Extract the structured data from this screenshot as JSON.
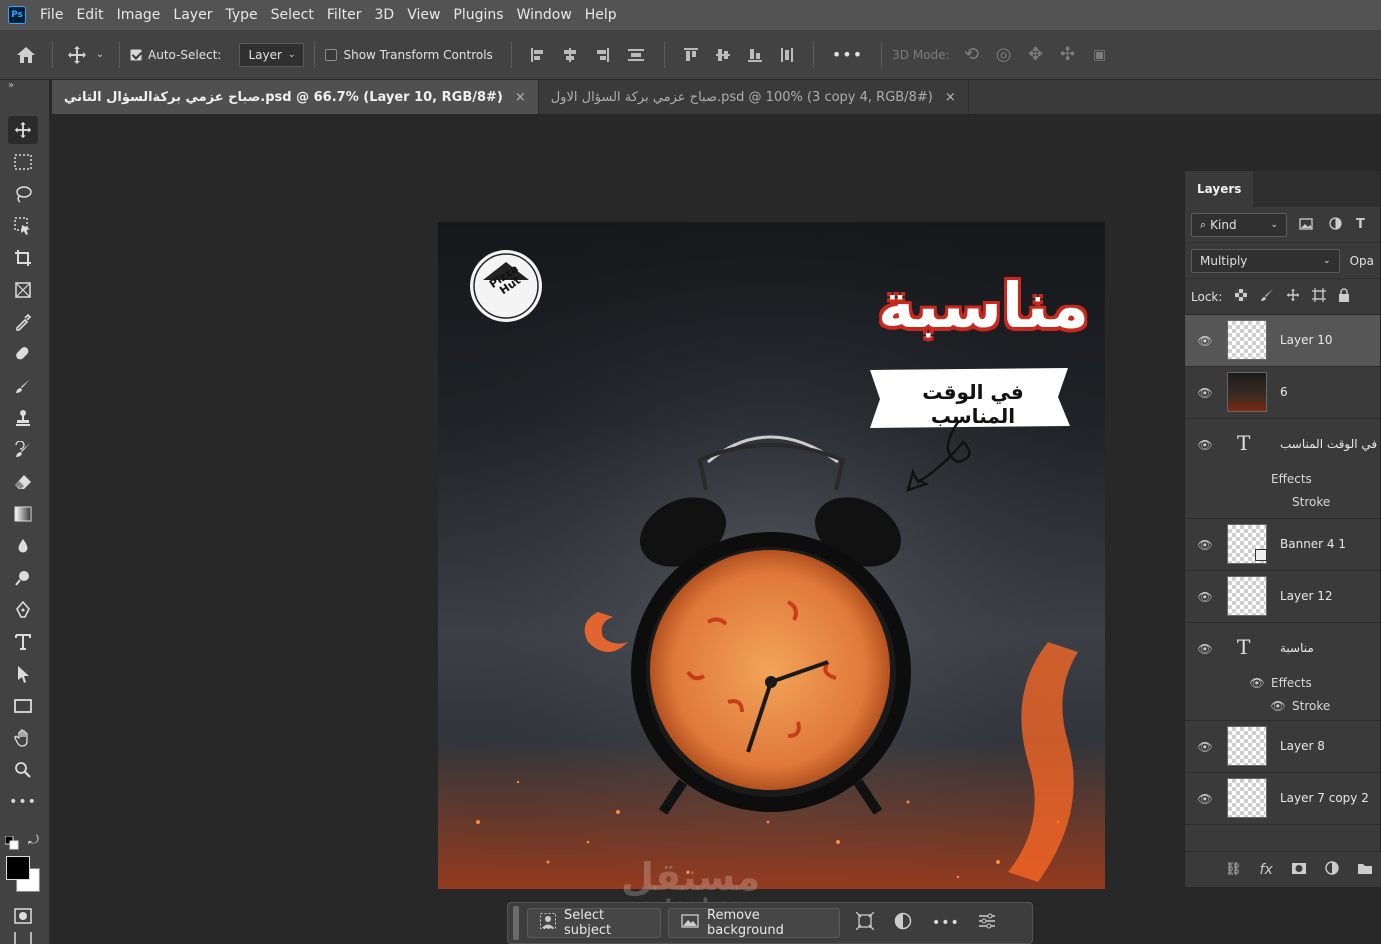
{
  "app": {
    "logo": "Ps"
  },
  "menu": [
    "File",
    "Edit",
    "Image",
    "Layer",
    "Type",
    "Select",
    "Filter",
    "3D",
    "View",
    "Plugins",
    "Window",
    "Help"
  ],
  "options": {
    "auto_select_label": "Auto-Select:",
    "auto_select_checked": true,
    "auto_select_target": "Layer",
    "show_transform_label": "Show Transform Controls",
    "more": "•••",
    "mode_3d_label": "3D Mode:"
  },
  "tabs": [
    {
      "label": "صباح عزمي بركةالسؤال التاني.psd @ 66.7% (Layer 10, RGB/8#)",
      "active": true,
      "close": "×"
    },
    {
      "label": "صباح عزمي بركة  السؤال الاول.psd @ 100% (3 copy 4, RGB/8#)",
      "active": false,
      "close": "×"
    }
  ],
  "artwork": {
    "logo_text": "Pizza Hut",
    "headline": "مناسبة",
    "banner_text": "في الوقت المناسب",
    "watermark_main": "مستقل",
    "watermark_sub": "mostaql.com"
  },
  "layers_panel": {
    "tab_label": "Layers",
    "filter_kind": "Kind",
    "blend_mode": "Multiply",
    "opacity_label": "Opa",
    "lock_label": "Lock:",
    "layers": [
      {
        "name": "Layer 10",
        "type": "pixel",
        "selected": true
      },
      {
        "name": "6",
        "type": "image",
        "selected": false
      },
      {
        "name": "في الوقت المناسب",
        "type": "text",
        "selected": false,
        "effects_label": "Effects",
        "effect": "Stroke"
      },
      {
        "name": "Banner 4 1",
        "type": "pixel",
        "selected": false
      },
      {
        "name": "Layer 12",
        "type": "pixel",
        "selected": false
      },
      {
        "name": "مناسبة",
        "type": "text",
        "selected": false,
        "effects_label": "Effects",
        "effect": "Stroke"
      },
      {
        "name": "Layer 8",
        "type": "pixel",
        "selected": false
      },
      {
        "name": "Layer 7 copy 2",
        "type": "pixel",
        "selected": false
      }
    ],
    "footer_fx": "fx"
  },
  "contextual_bar": {
    "select_subject": "Select subject",
    "remove_background": "Remove background",
    "more": "•••"
  },
  "colors": {
    "menubar": "#535353",
    "panel": "#424242",
    "canvas_bg": "#282828",
    "accent_red": "#c8281e"
  }
}
